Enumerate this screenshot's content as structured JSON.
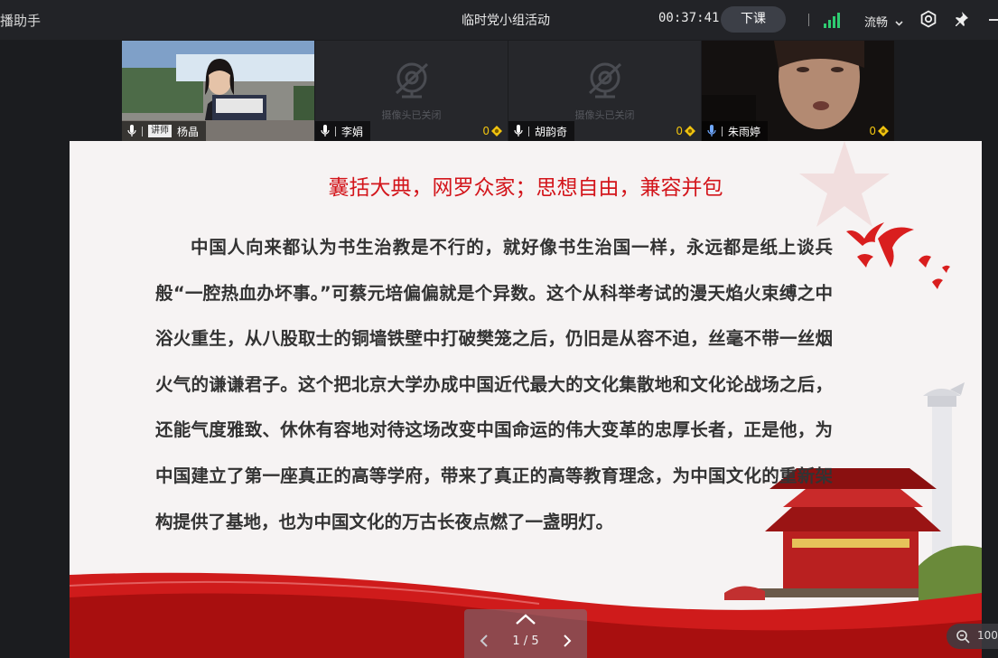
{
  "app": {
    "title": "播助手"
  },
  "header": {
    "meeting_title": "临时党小组活动",
    "timer": "00:37:41",
    "end_button": "下课",
    "network_quality": "流畅"
  },
  "participants": [
    {
      "name": "杨晶",
      "role": "讲师",
      "camera": "on",
      "score": ""
    },
    {
      "name": "李娟",
      "role": "",
      "camera": "off",
      "camera_off_text": "摄像头已关闭",
      "score": "0"
    },
    {
      "name": "胡韵奇",
      "role": "",
      "camera": "off",
      "camera_off_text": "摄像头已关闭",
      "score": "0"
    },
    {
      "name": "朱雨婷",
      "role": "",
      "camera": "on",
      "score": "0"
    }
  ],
  "slide": {
    "title": "囊括大典，网罗众家；思想自由，兼容并包",
    "body": "中国人向来都认为书生治教是不行的，就好像书生治国一样，永远都是纸上谈兵般“一腔热血办坏事。”可蔡元培偏偏就是个异数。这个从科举考试的漫天焰火束缚之中浴火重生，从八股取士的铜墙铁壁中打破樊笼之后，仍旧是从容不迫，丝毫不带一丝烟火气的谦谦君子。这个把北京大学办成中国近代最大的文化集散地和文化论战场之后，还能气度雅致、休休有容地对待这场改变中国命运的伟大变革的忠厚长者，正是他，为中国建立了第一座真正的高等学府，带来了真正的高等教育理念，为中国文化的重新架构提供了基地，也为中国文化的万古长夜点燃了一盏明灯。"
  },
  "pager": {
    "page_indicator": "1 / 5"
  },
  "zoom": {
    "value": "100"
  },
  "colors": {
    "accent_red": "#d3151b",
    "signal_green": "#2ecc71",
    "active_border": "#4a7cf0"
  }
}
